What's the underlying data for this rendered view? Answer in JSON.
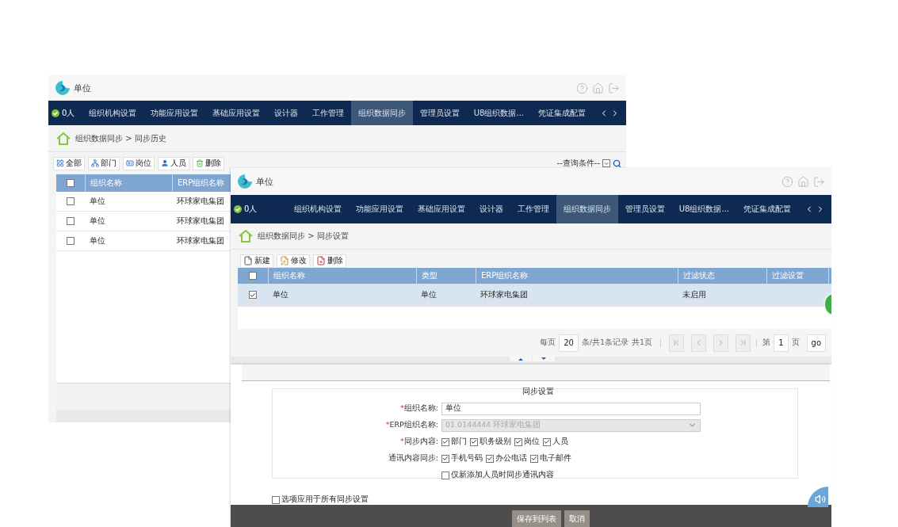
{
  "windows": [
    {
      "kind": "history",
      "title": "单位",
      "online": "0人",
      "nav_tabs": [
        {
          "label": "组织机构设置",
          "selected": false
        },
        {
          "label": "功能应用设置",
          "selected": false
        },
        {
          "label": "基础应用设置",
          "selected": false
        },
        {
          "label": "设计器",
          "selected": false
        },
        {
          "label": "工作管理",
          "selected": false
        },
        {
          "label": "组织数据同步",
          "selected": true
        },
        {
          "label": "管理员设置",
          "selected": false
        },
        {
          "label": "U8组织数据...",
          "selected": false
        },
        {
          "label": "凭证集成配置",
          "selected": false
        }
      ],
      "breadcrumb": "组织数据同步 > 同步历史",
      "toolbar": [
        {
          "kind": "all",
          "label": "全部"
        },
        {
          "kind": "dept",
          "label": "部门"
        },
        {
          "kind": "post",
          "label": "岗位"
        },
        {
          "kind": "person",
          "label": "人员"
        },
        {
          "kind": "trash",
          "label": "删除"
        }
      ],
      "query": {
        "value": "--查询条件--"
      },
      "table": {
        "header_checked": false,
        "columns": [
          "组织名称",
          "ERP组织名称"
        ],
        "rows": [
          {
            "checked": false,
            "cells": [
              "单位",
              "环球家电集团"
            ]
          },
          {
            "checked": false,
            "cells": [
              "单位",
              "环球家电集团"
            ]
          },
          {
            "checked": false,
            "cells": [
              "单位",
              "环球家电集团"
            ]
          }
        ]
      }
    },
    {
      "kind": "settings",
      "title": "单位",
      "online": "0人",
      "nav_tabs": [
        {
          "label": "组织机构设置",
          "selected": false
        },
        {
          "label": "功能应用设置",
          "selected": false
        },
        {
          "label": "基础应用设置",
          "selected": false
        },
        {
          "label": "设计器",
          "selected": false
        },
        {
          "label": "工作管理",
          "selected": false
        },
        {
          "label": "组织数据同步",
          "selected": true
        },
        {
          "label": "管理员设置",
          "selected": false
        },
        {
          "label": "U8组织数据...",
          "selected": false
        },
        {
          "label": "凭证集成配置",
          "selected": false
        }
      ],
      "breadcrumb": "组织数据同步 > 同步设置",
      "toolbar": [
        {
          "kind": "new",
          "label": "新建"
        },
        {
          "kind": "edit",
          "label": "修改"
        },
        {
          "kind": "delete",
          "label": "删除"
        }
      ],
      "table": {
        "header_checked": false,
        "columns": [
          "组织名称",
          "类型",
          "ERP组织名称",
          "过滤状态",
          "过滤设置"
        ],
        "rows": [
          {
            "checked": true,
            "selected": true,
            "cells": [
              "单位",
              "单位",
              "环球家电集团",
              "未启用"
            ]
          }
        ]
      },
      "pager": {
        "per_page_label": "每页",
        "per_page": "20",
        "summary": "条/共1条记录",
        "total_pages": "共1页",
        "page_label": "第",
        "page": "1",
        "page_unit": "页",
        "go": "go"
      },
      "form": {
        "title": "同步设置",
        "fields": [
          {
            "kind": "text",
            "mark": "*",
            "label": "组织名称:",
            "value": "单位"
          },
          {
            "kind": "select",
            "mark": "*",
            "label": "ERP组织名称:",
            "value": "01.0144444 环球家电集团",
            "disabled": true
          },
          {
            "kind": "checks",
            "mark": "*",
            "label": "同步内容:",
            "options": [
              {
                "label": "部门",
                "checked": true
              },
              {
                "label": "职务级别",
                "checked": true
              },
              {
                "label": "岗位",
                "checked": true
              },
              {
                "label": "人员",
                "checked": true
              }
            ]
          },
          {
            "kind": "checks",
            "label": "通讯内容同步:",
            "options": [
              {
                "label": "手机号码",
                "checked": true
              },
              {
                "label": "办公电话",
                "checked": true
              },
              {
                "label": "电子邮件",
                "checked": true
              }
            ]
          },
          {
            "kind": "checks",
            "options": [
              {
                "label": "仅新添加人员时同步通讯内容",
                "checked": false
              }
            ]
          }
        ]
      },
      "apply_all": {
        "label": "选项应用于所有同步设置",
        "checked": false
      },
      "footer_buttons": [
        "保存到列表",
        "取消"
      ]
    }
  ]
}
